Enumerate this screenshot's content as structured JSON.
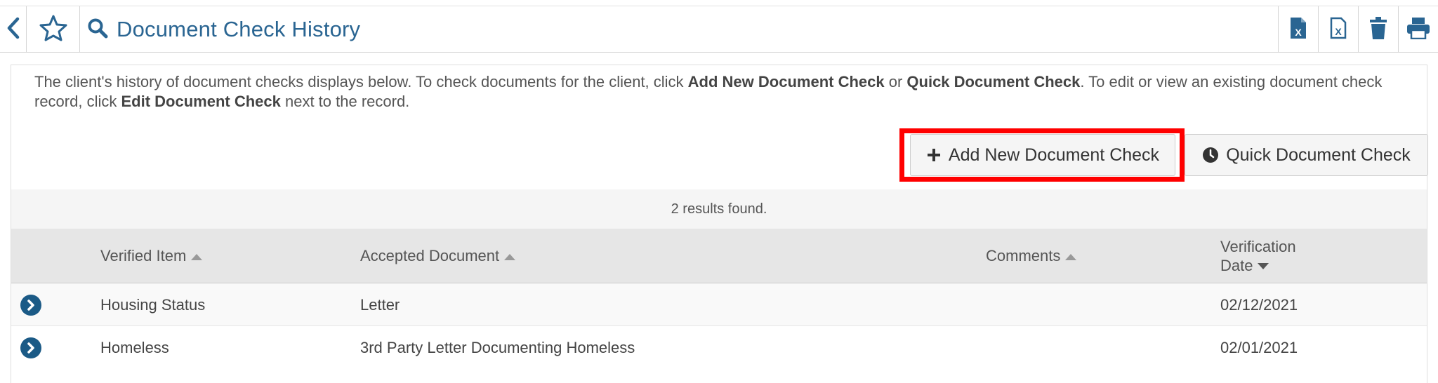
{
  "header": {
    "title": "Document Check History",
    "icons": [
      "back-chevron-icon",
      "star-icon",
      "search-icon",
      "excel-export-icon",
      "excel-export-all-icon",
      "trash-icon",
      "print-icon"
    ]
  },
  "intro": {
    "part1": "The client's history of document checks displays below.  To check documents for the client, click ",
    "bold1": "Add New Document Check",
    "part2": " or ",
    "bold2": "Quick Document Check",
    "part3": ".  To edit or view an existing document check record, click ",
    "bold3": "Edit Document Check",
    "part4": " next to the record."
  },
  "buttons": {
    "add_new": "Add New Document Check",
    "quick": "Quick Document Check"
  },
  "results_text": "2 results found.",
  "table": {
    "headers": {
      "verified_item": "Verified Item",
      "accepted_document": "Accepted Document",
      "comments": "Comments",
      "verification_date_line1": "Verification",
      "verification_date_line2": "Date"
    },
    "rows": [
      {
        "verified_item": "Housing Status",
        "accepted_document": "Letter",
        "comments": "",
        "verification_date": "02/12/2021"
      },
      {
        "verified_item": "Homeless",
        "accepted_document": "3rd Party Letter Documenting Homeless",
        "comments": "",
        "verification_date": "02/01/2021"
      }
    ]
  },
  "colors": {
    "brand_blue": "#2a6592",
    "highlight_red": "#ff0000",
    "row_button": "#1b5a86"
  }
}
